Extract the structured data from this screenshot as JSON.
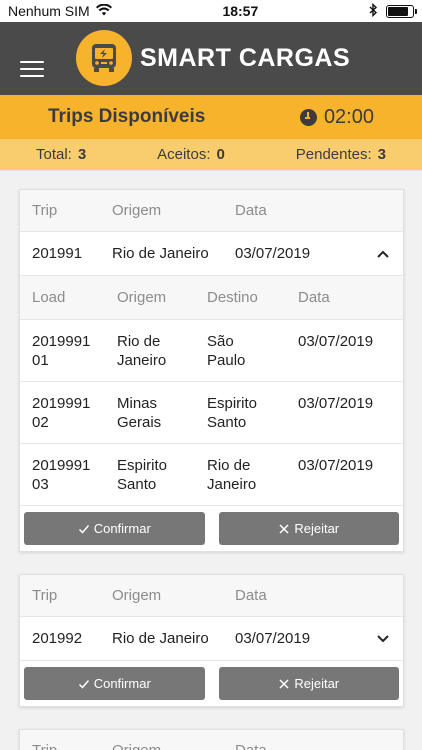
{
  "status": {
    "carrier": "Nenhum SIM",
    "time": "18:57"
  },
  "app": {
    "brand": "SMART CARGAS"
  },
  "titlebar": {
    "title": "Trips Disponíveis",
    "timer": "02:00"
  },
  "counters": {
    "total_label": "Total:",
    "total_value": "3",
    "accepted_label": "Aceitos:",
    "accepted_value": "0",
    "pending_label": "Pendentes:",
    "pending_value": "3"
  },
  "columns": {
    "trip": "Trip",
    "origin": "Origem",
    "date": "Data",
    "load": "Load",
    "destination": "Destino"
  },
  "actions": {
    "confirm": "Confirmar",
    "reject": "Rejeitar"
  },
  "trips": [
    {
      "id": "201991",
      "origin": "Rio de Janeiro",
      "date": "03/07/2019",
      "expanded": true,
      "loads": [
        {
          "id_l1": "2019991",
          "id_l2": "01",
          "orig_l1": "Rio de",
          "orig_l2": "Janeiro",
          "dest_l1": "São",
          "dest_l2": "Paulo",
          "date": "03/07/2019"
        },
        {
          "id_l1": "2019991",
          "id_l2": "02",
          "orig_l1": "Minas",
          "orig_l2": "Gerais",
          "dest_l1": "Espirito",
          "dest_l2": "Santo",
          "date": "03/07/2019"
        },
        {
          "id_l1": "2019991",
          "id_l2": "03",
          "orig_l1": "Espirito",
          "orig_l2": "Santo",
          "dest_l1": "Rio de",
          "dest_l2": "Janeiro",
          "date": "03/07/2019"
        }
      ]
    },
    {
      "id": "201992",
      "origin": "Rio de Janeiro",
      "date": "03/07/2019",
      "expanded": false
    }
  ],
  "colors": {
    "accent": "#f7b32b",
    "accent_light": "#f9cd6e",
    "header": "#4a4a4a",
    "button": "#777777"
  },
  "icons": {
    "menu": "hamburger-icon",
    "logo": "bus-logo-icon",
    "timer": "clock-icon",
    "collapse": "chevron-up-icon",
    "expand": "chevron-down-icon",
    "confirm": "check-icon",
    "reject": "close-icon"
  }
}
